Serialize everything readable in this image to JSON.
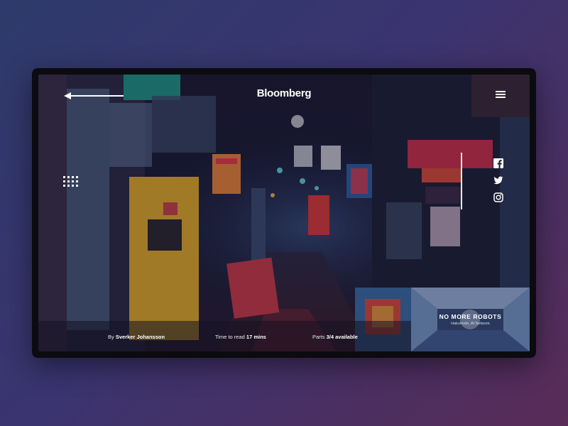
{
  "header": {
    "brand": "Bloomberg"
  },
  "meta": {
    "author_prefix": "By",
    "author_name": "Sverker Johansson",
    "read_prefix": "Time to read",
    "read_value": "17 mins",
    "parts_prefix": "Parts",
    "parts_value": "3/4 available"
  },
  "next_story": {
    "title": "NO MORE ROBOTS",
    "subtitle": "Hakuhodo, AI Network"
  },
  "social": {
    "icons": [
      "facebook-icon",
      "twitter-icon",
      "instagram-icon"
    ]
  },
  "colors": {
    "page_bg_start": "#2e3a6b",
    "page_bg_end": "#5a2c57",
    "frame": "#0b0b10",
    "neon_red": "#e03a4a",
    "neon_cyan": "#3fc3d2",
    "door_yellow": "#d9a62b"
  }
}
